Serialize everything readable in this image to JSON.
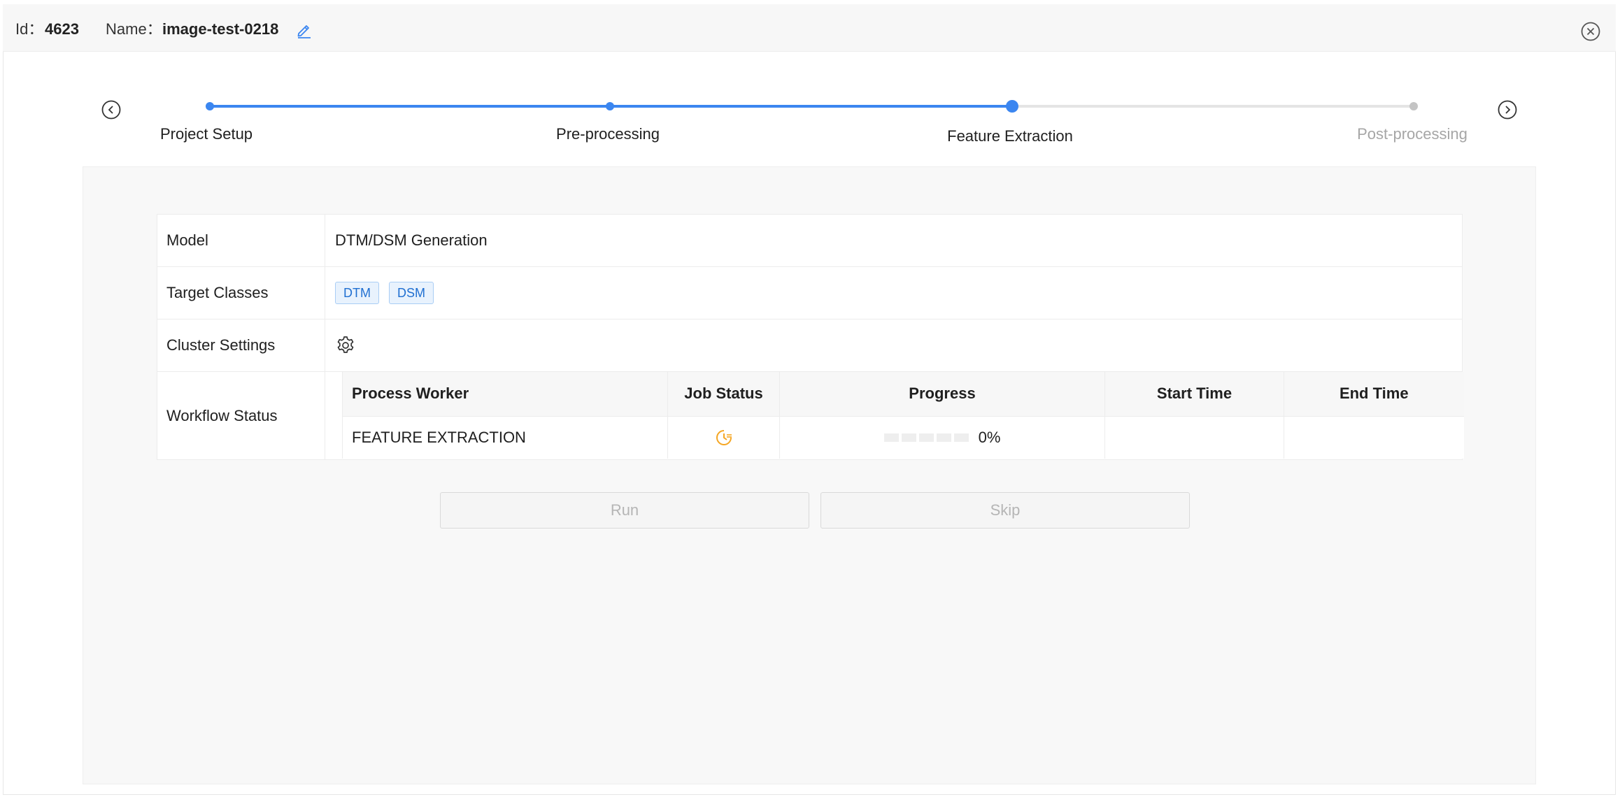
{
  "header": {
    "id_label": "Id：",
    "id_value": "4623",
    "name_label": "Name：",
    "name_value": "image-test-0218",
    "edit_icon": "edit-icon",
    "close_icon": "close-circle-icon"
  },
  "stepper": {
    "steps": [
      {
        "label": "Project Setup",
        "state": "done"
      },
      {
        "label": "Pre-processing",
        "state": "done"
      },
      {
        "label": "Feature Extraction",
        "state": "current"
      },
      {
        "label": "Post-processing",
        "state": "pending"
      }
    ],
    "prev_icon": "chevron-left-circle-icon",
    "next_icon": "chevron-right-circle-icon"
  },
  "details": {
    "model_label": "Model",
    "model_value": "DTM/DSM Generation",
    "target_label": "Target Classes",
    "target_tags": [
      "DTM",
      "DSM"
    ],
    "cluster_label": "Cluster Settings",
    "cluster_icon": "gear-icon",
    "workflow_label": "Workflow Status"
  },
  "workflow": {
    "columns": [
      "Process Worker",
      "Job Status",
      "Progress",
      "Start Time",
      "End Time"
    ],
    "rows": [
      {
        "worker": "FEATURE EXTRACTION",
        "status_icon": "clock-pending-icon",
        "progress": "0%",
        "progress_value": 0,
        "start_time": "",
        "end_time": ""
      }
    ]
  },
  "actions": {
    "run_label": "Run",
    "skip_label": "Skip"
  },
  "colors": {
    "accent": "#3b86f0",
    "pending": "#cfcfcf",
    "status_warning": "#f5a623",
    "tag_text": "#1f6fd1"
  }
}
